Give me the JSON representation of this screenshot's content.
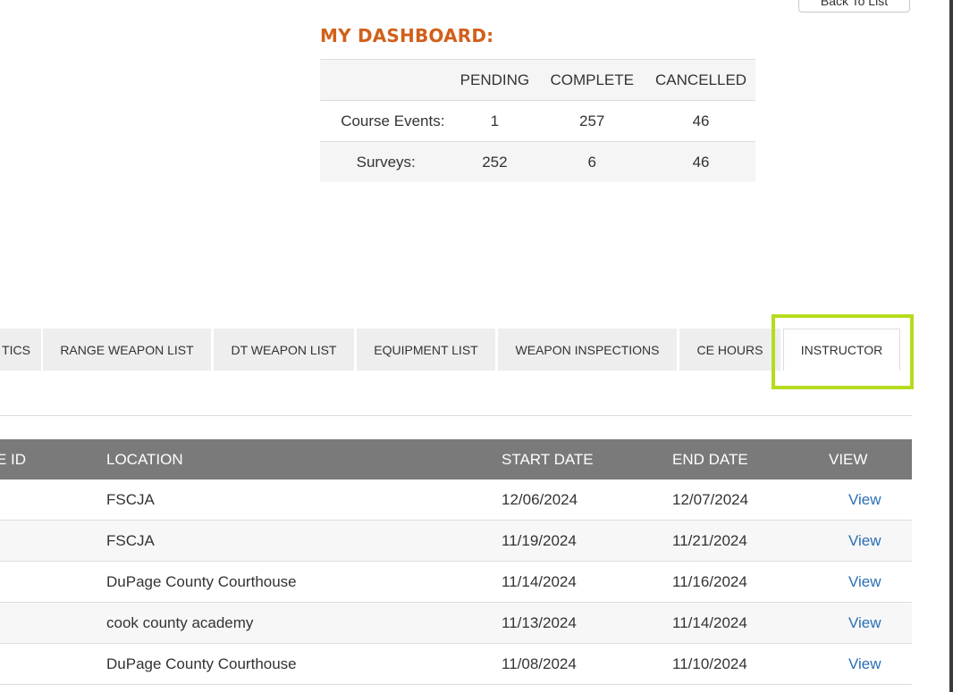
{
  "header": {
    "back_button_label": "Back To List"
  },
  "dashboard": {
    "title": "MY DASHBOARD:",
    "columns": [
      "PENDING",
      "COMPLETE",
      "CANCELLED"
    ],
    "rows": [
      {
        "label": "Course Events:",
        "pending": "1",
        "complete": "257",
        "cancelled": "46"
      },
      {
        "label": "Surveys:",
        "pending": "252",
        "complete": "6",
        "cancelled": "46"
      }
    ]
  },
  "tabs": {
    "items": [
      {
        "label": "TICS"
      },
      {
        "label": "RANGE WEAPON LIST"
      },
      {
        "label": "DT WEAPON LIST"
      },
      {
        "label": "EQUIPMENT LIST"
      },
      {
        "label": "WEAPON INSPECTIONS"
      },
      {
        "label": "CE HOURS"
      },
      {
        "label": "INSTRUCTOR"
      }
    ],
    "active": "INSTRUCTOR"
  },
  "table": {
    "headers": [
      "E ID",
      "LOCATION",
      "START DATE",
      "END DATE",
      "VIEW"
    ],
    "rows": [
      {
        "location": "FSCJA",
        "start": "12/06/2024",
        "end": "12/07/2024",
        "view": "View"
      },
      {
        "location": "FSCJA",
        "start": "11/19/2024",
        "end": "11/21/2024",
        "view": "View"
      },
      {
        "location": "DuPage County Courthouse",
        "start": "11/14/2024",
        "end": "11/16/2024",
        "view": "View"
      },
      {
        "location": "cook county academy",
        "start": "11/13/2024",
        "end": "11/14/2024",
        "view": "View"
      },
      {
        "location": "DuPage County Courthouse",
        "start": "11/08/2024",
        "end": "11/10/2024",
        "view": "View"
      }
    ]
  },
  "colors": {
    "accent_orange": "#d2601a",
    "highlight_green": "#b5dc1e",
    "header_gray": "#7a7a7a",
    "link_blue": "#2a6fb5"
  }
}
